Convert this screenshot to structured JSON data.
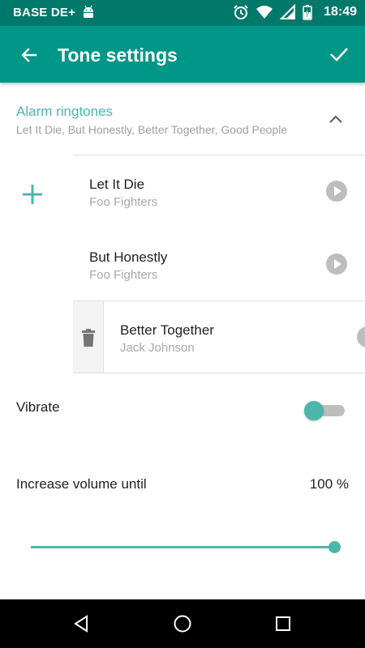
{
  "status_bar": {
    "carrier": "BASE DE+",
    "time": "18:49",
    "icons": [
      "android-icon",
      "alarm-clock-icon",
      "wifi-icon",
      "signal-icon",
      "battery-charging-icon"
    ]
  },
  "app_bar": {
    "title": "Tone settings",
    "back_icon": "arrow-back-icon",
    "confirm_icon": "check-icon",
    "color": "#009688",
    "status_color": "#00796B"
  },
  "alarm_section": {
    "title": "Alarm ringtones",
    "summary": "Let It Die, But Honestly, Better Together, Good People",
    "expanded": true,
    "accent": "#4DB6AC"
  },
  "ringtones": [
    {
      "title": "Let It Die",
      "artist": "Foo Fighters"
    },
    {
      "title": "But Honestly",
      "artist": "Foo Fighters"
    },
    {
      "title": "Better Together",
      "artist": "Jack Johnson",
      "swiped": true
    }
  ],
  "vibrate": {
    "label": "Vibrate",
    "enabled": true
  },
  "volume": {
    "label": "Increase volume until",
    "value_text": "100 %",
    "value": 100
  },
  "nav_bar": {
    "icons": [
      "back-triangle-icon",
      "home-circle-icon",
      "recents-square-icon"
    ]
  }
}
